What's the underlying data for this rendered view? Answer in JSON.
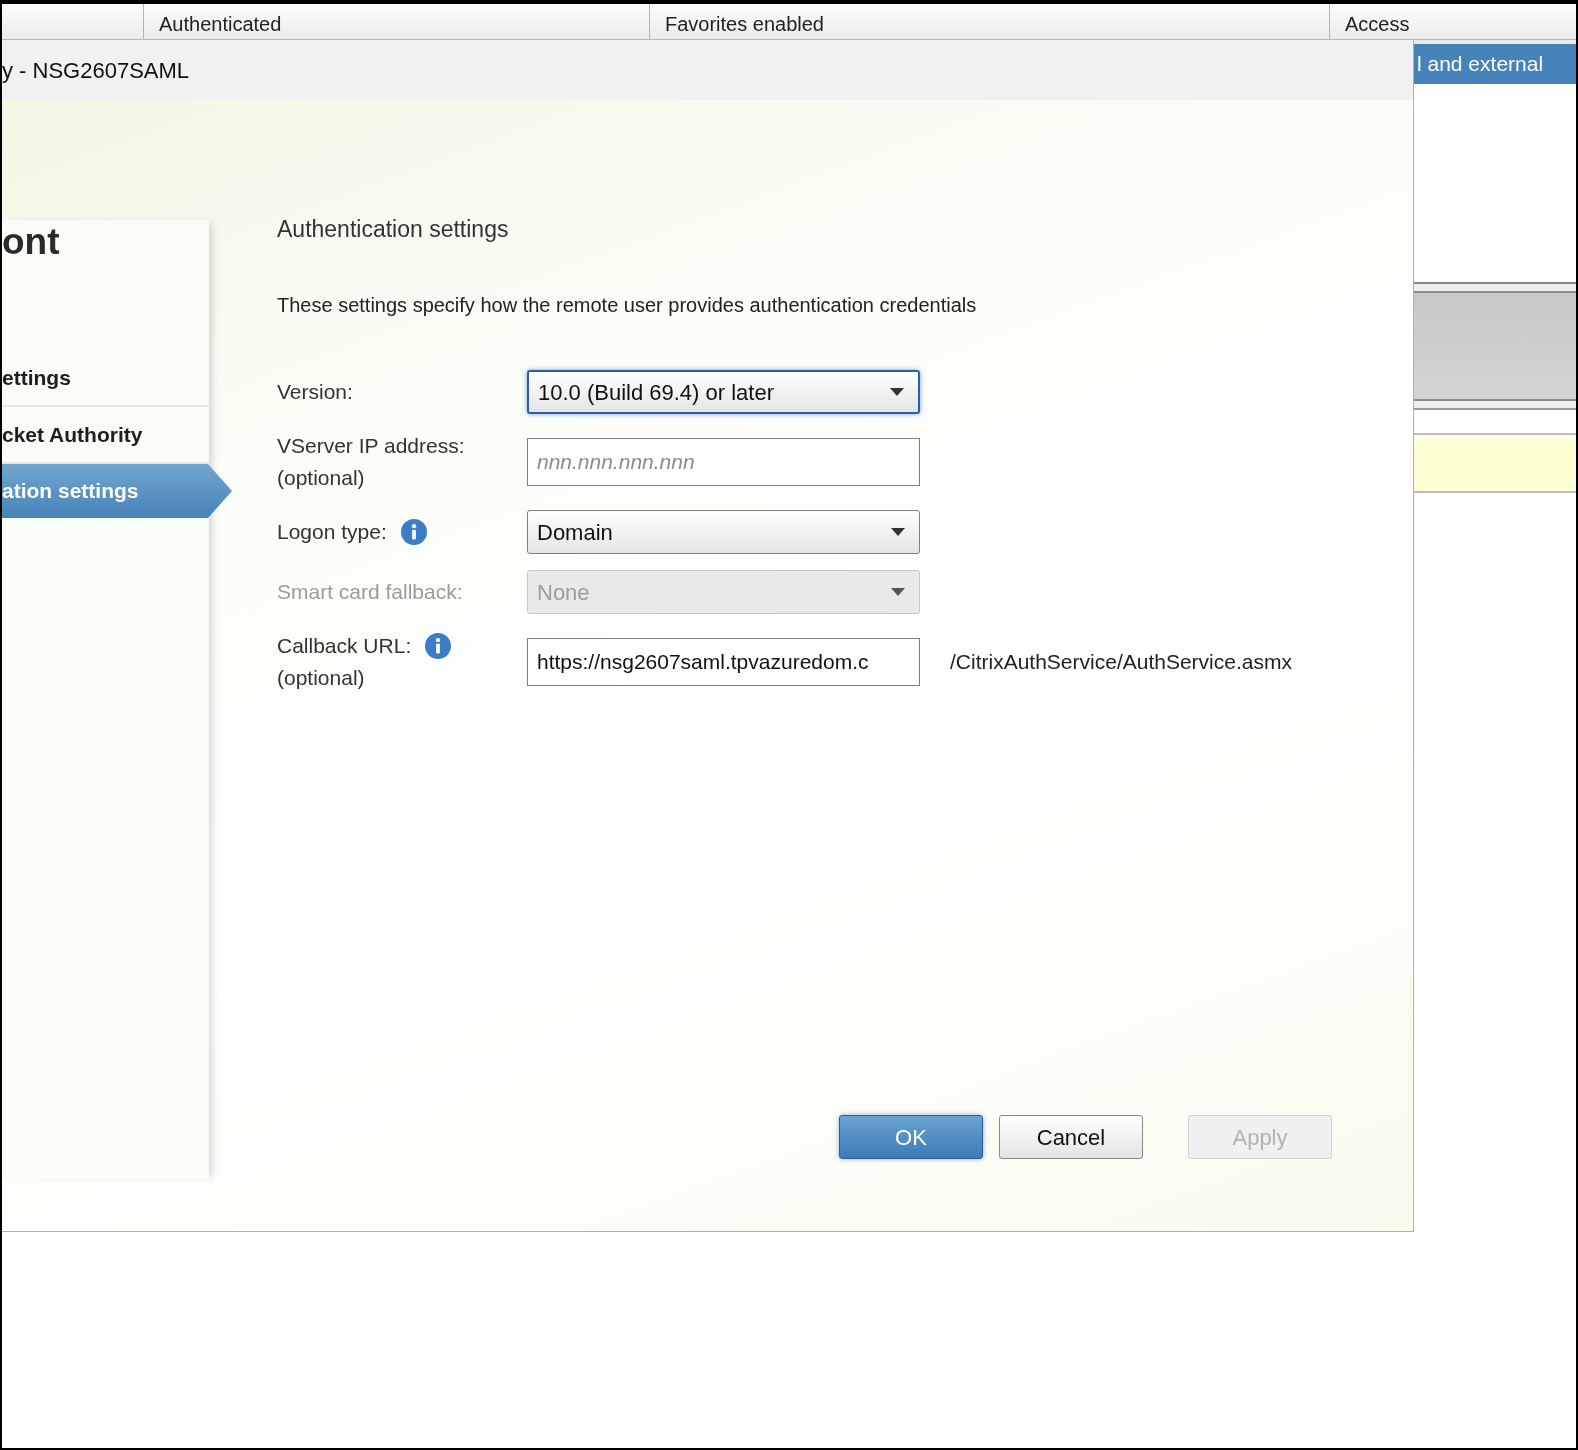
{
  "background_table": {
    "columns": [
      {
        "label": "Authenticated"
      },
      {
        "label": "Favorites enabled"
      },
      {
        "label": "Access"
      }
    ],
    "rows": [
      {
        "access": "l and external",
        "selected": true
      }
    ]
  },
  "dialog": {
    "title": "y - NSG2607SAML",
    "nav": {
      "heading": "ont",
      "items": [
        {
          "label": "ettings",
          "selected": false
        },
        {
          "label": "cket Authority",
          "selected": false
        },
        {
          "label": "ation settings",
          "selected": true
        }
      ]
    },
    "section_title": "Authentication settings",
    "description": "These settings specify how the remote user provides authentication credentials",
    "fields": [
      {
        "kind": "select",
        "label": "Version:",
        "info": false,
        "value": "10.0 (Build 69.4) or later",
        "focused": true,
        "disabled": false
      },
      {
        "kind": "text",
        "label": "VServer IP address:",
        "note": "(optional)",
        "info": false,
        "placeholder": "nnn.nnn.nnn.nnn",
        "focused": false,
        "disabled": false
      },
      {
        "kind": "select",
        "label": "Logon type:",
        "info": true,
        "value": "Domain",
        "focused": false,
        "disabled": false
      },
      {
        "kind": "select",
        "label": "Smart card fallback:",
        "info": false,
        "value": "None",
        "focused": false,
        "disabled": true
      },
      {
        "kind": "text",
        "label": "Callback URL:",
        "note": "(optional)",
        "info": true,
        "value": "https://nsg2607saml.tpvazuredom.c",
        "suffix": "/CitrixAuthService/AuthService.asmx",
        "focused": false,
        "disabled": false
      }
    ],
    "buttons": [
      {
        "label": "OK",
        "kind": "primary",
        "disabled": false
      },
      {
        "label": "Cancel",
        "kind": "default",
        "disabled": false
      },
      {
        "label": "Apply",
        "kind": "default",
        "disabled": true
      }
    ]
  }
}
